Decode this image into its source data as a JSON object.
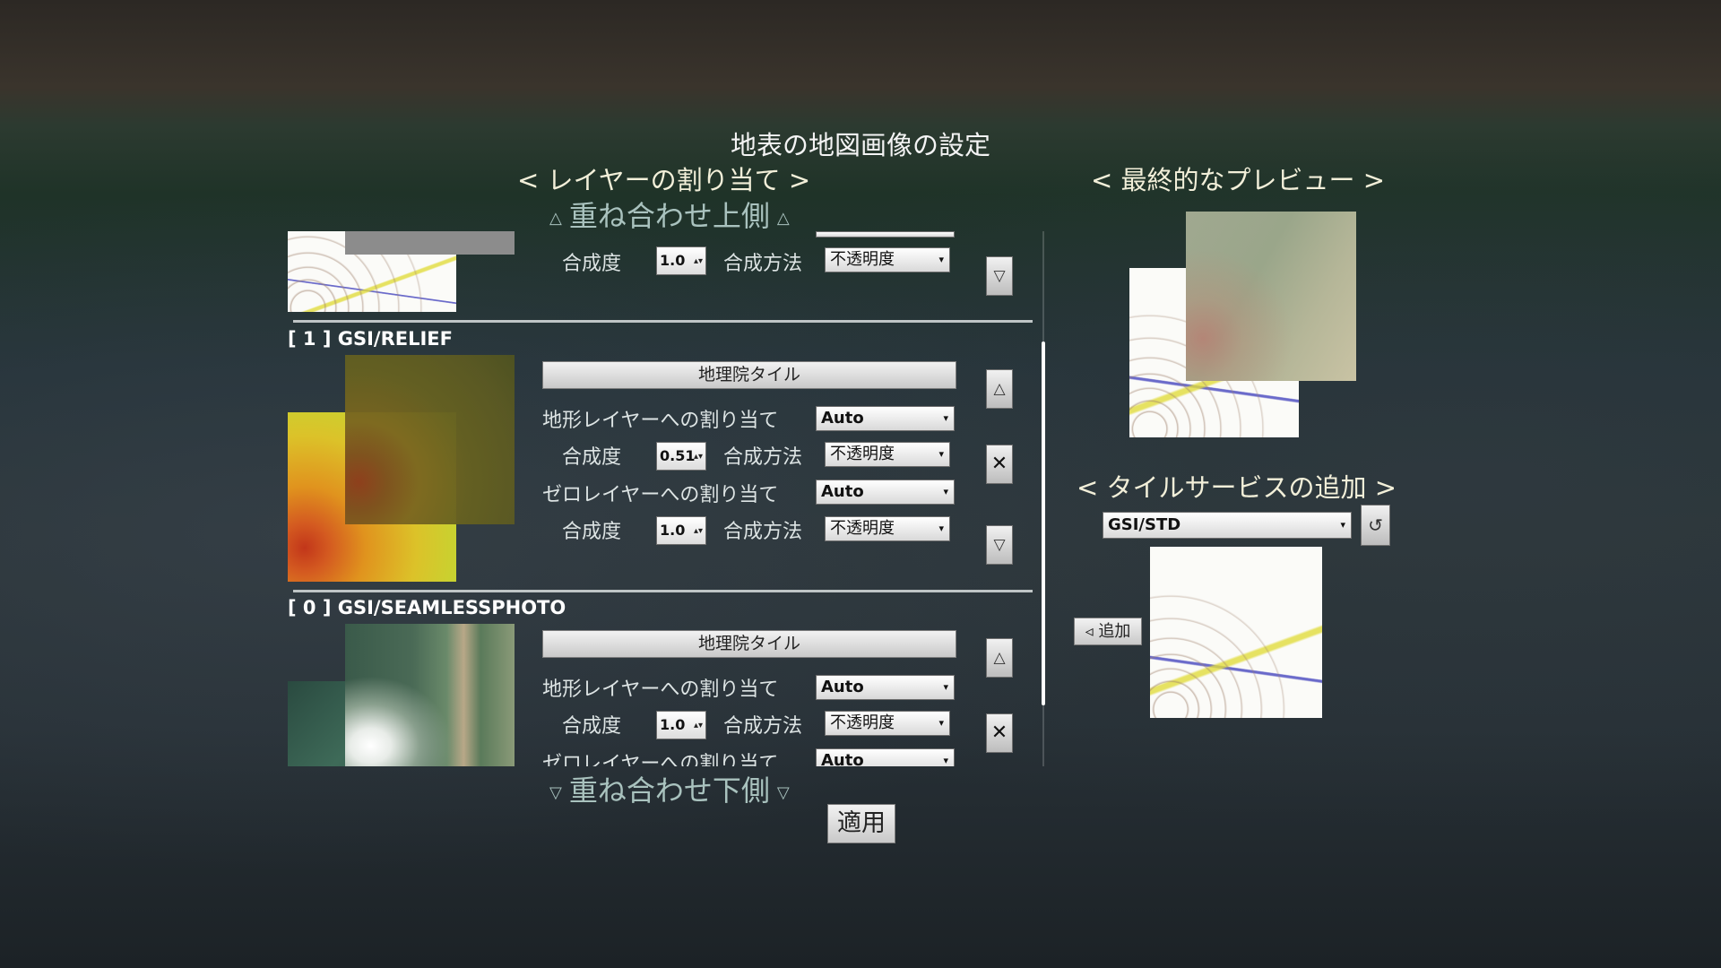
{
  "dialog": {
    "title": "地表の地図画像の設定"
  },
  "layer_panel": {
    "header": "< レイヤーの割り当て >",
    "top_hint": "重ね合わせ上側",
    "bottom_hint": "重ね合わせ下側",
    "partial_top_layer": {
      "opacity_label": "合成度",
      "opacity_value": "1.0",
      "blend_label": "合成方法",
      "blend_value": "不透明度",
      "move_down": "▽"
    },
    "layers": [
      {
        "title": "[ 1 ] GSI/RELIEF",
        "source_button": "地理院タイル",
        "terrain_label": "地形レイヤーへの割り当て",
        "terrain_value": "Auto",
        "opacity_label": "合成度",
        "opacity_value": "0.51",
        "blend_label": "合成方法",
        "blend_value": "不透明度",
        "zero_label": "ゼロレイヤーへの割り当て",
        "zero_value": "Auto",
        "zero_opacity_label": "合成度",
        "zero_opacity_value": "1.0",
        "zero_blend_label": "合成方法",
        "zero_blend_value": "不透明度",
        "up": "△",
        "delete": "✕",
        "down": "▽"
      },
      {
        "title": "[ 0 ] GSI/SEAMLESSPHOTO",
        "source_button": "地理院タイル",
        "terrain_label": "地形レイヤーへの割り当て",
        "terrain_value": "Auto",
        "opacity_label": "合成度",
        "opacity_value": "1.0",
        "blend_label": "合成方法",
        "blend_value": "不透明度",
        "zero_label": "ゼロレイヤーへの割り当て",
        "zero_value": "Auto",
        "up": "△",
        "delete": "✕"
      }
    ]
  },
  "preview_panel": {
    "header": "< 最終的なプレビュー >"
  },
  "add_panel": {
    "header": "< タイルサービスの追加 >",
    "service_value": "GSI/STD",
    "reload_icon": "↺",
    "add_button": "◃ 追加"
  },
  "apply_button": "適用",
  "icons": {
    "select_arrow": "▾",
    "spin_arrow": "▴▾",
    "hint_up": "△",
    "hint_down": "▽"
  }
}
